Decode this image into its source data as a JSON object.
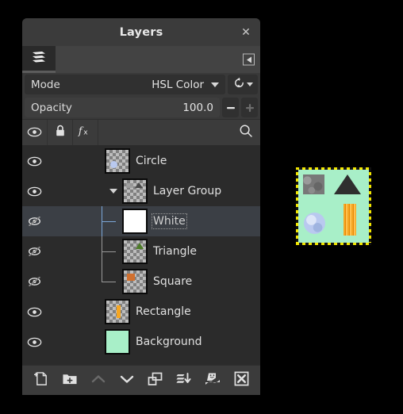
{
  "window": {
    "title": "Layers",
    "close_label": "✕"
  },
  "tabstrip": {
    "active_tab_icon": "layers-stack-icon",
    "menu_button_icon": "tab-menu-icon"
  },
  "controls": {
    "mode": {
      "label": "Mode",
      "value": "HSL Color",
      "dropdown_icon": "chevron-down-icon",
      "reset_icon": "reset-arrow-icon",
      "reset_dropdown_icon": "chevron-down-icon"
    },
    "opacity": {
      "label": "Opacity",
      "value": "100.0",
      "percent": 100,
      "decrement_label": "–",
      "increment_label": "+"
    }
  },
  "list_header": {
    "visibility_icon": "eye-icon",
    "lock_icon": "lock-icon",
    "effects_icon": "fx-icon",
    "search_icon": "search-icon"
  },
  "layers": [
    {
      "name": "Circle",
      "visible": true,
      "indent": 0,
      "type": "layer",
      "thumb": "checker-circle",
      "selected": false
    },
    {
      "name": "Layer Group",
      "visible": true,
      "indent": 0,
      "type": "group",
      "expanded": true,
      "thumb": "checker-group",
      "selected": false
    },
    {
      "name": "White",
      "visible": false,
      "indent": 1,
      "type": "layer",
      "thumb": "solid-white",
      "selected": true
    },
    {
      "name": "Triangle",
      "visible": false,
      "indent": 1,
      "type": "layer",
      "thumb": "checker-triangle",
      "selected": false
    },
    {
      "name": "Square",
      "visible": false,
      "indent": 1,
      "type": "layer",
      "thumb": "checker-square",
      "selected": false
    },
    {
      "name": "Rectangle",
      "visible": true,
      "indent": 0,
      "type": "layer",
      "thumb": "checker-rectangle",
      "selected": false
    },
    {
      "name": "Background",
      "visible": true,
      "indent": 0,
      "type": "layer",
      "thumb": "solid-mint",
      "selected": false
    }
  ],
  "bottom_toolbar": [
    {
      "name": "new-layer-button",
      "icon": "new-layer-icon",
      "enabled": true
    },
    {
      "name": "new-layer-group-button",
      "icon": "new-group-icon",
      "enabled": true
    },
    {
      "name": "raise-layer-button",
      "icon": "chevron-up-icon",
      "enabled": false
    },
    {
      "name": "lower-layer-button",
      "icon": "chevron-down-icon",
      "enabled": true
    },
    {
      "name": "duplicate-layer-button",
      "icon": "duplicate-icon",
      "enabled": true
    },
    {
      "name": "merge-down-button",
      "icon": "merge-down-icon",
      "enabled": true
    },
    {
      "name": "anchor-layer-button",
      "icon": "anchor-mask-icon",
      "enabled": true
    },
    {
      "name": "delete-layer-button",
      "icon": "delete-x-icon",
      "enabled": true
    }
  ],
  "canvas_preview": {
    "background_color": "#A8EFC8",
    "shapes": [
      {
        "name": "square",
        "color": "#787878"
      },
      {
        "name": "triangle",
        "color": "#2F2F2F"
      },
      {
        "name": "circle",
        "color": "#B9C9EF"
      },
      {
        "name": "rectangle",
        "color": "#F5A623"
      }
    ]
  }
}
